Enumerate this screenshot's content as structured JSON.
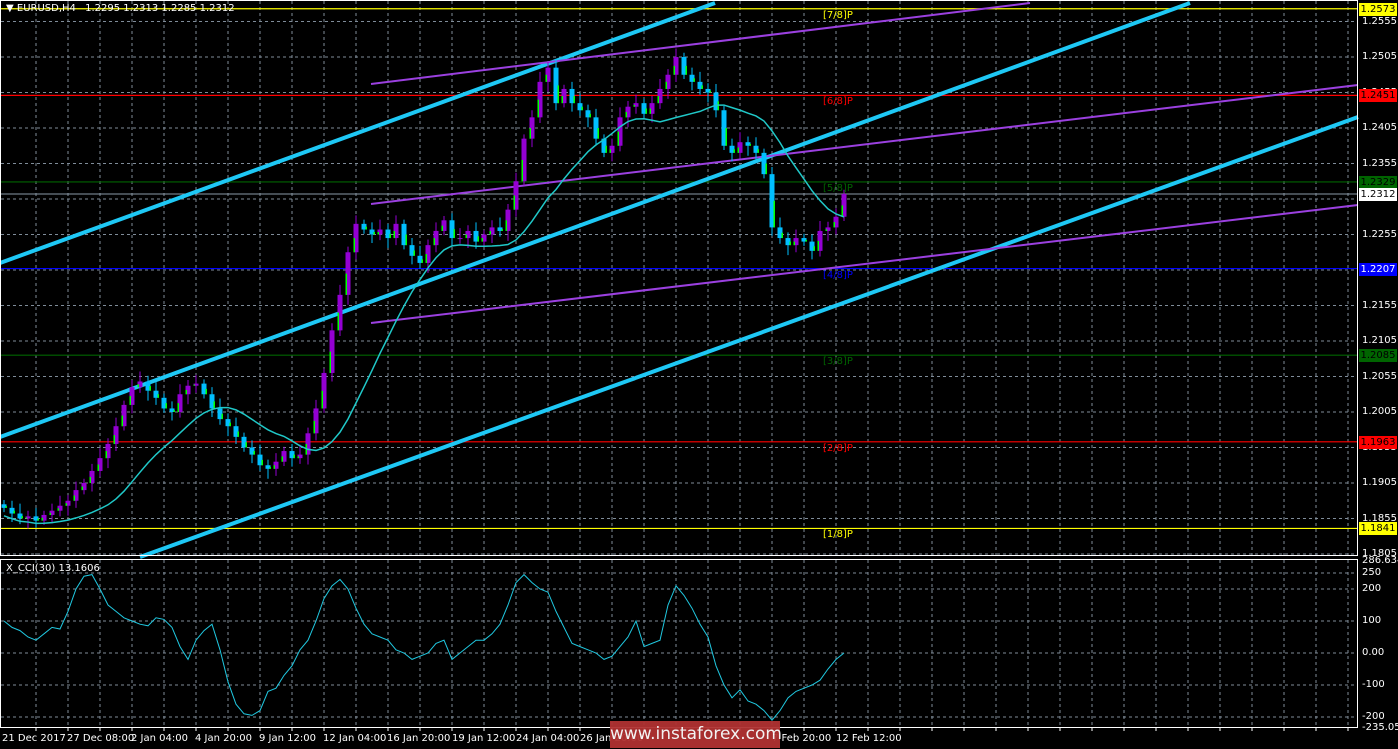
{
  "header": {
    "symbol_label": "EURUSD,H4",
    "ohlc": "1.2295 1.2313 1.2285 1.2312"
  },
  "colors": {
    "background": "#000000",
    "grid": "#7f8c99",
    "bull_candle": "#9400d3",
    "bear_candle": "#00bfff",
    "candle_wick_accent": "#00ff00",
    "moving_average": "#20c8c8",
    "channel_lines": "#1ec8f5",
    "purple_lines": "#9b40e0",
    "cci_line": "#20c8e0"
  },
  "price_axis": {
    "ticks": [
      "1.2555",
      "1.2505",
      "1.2455",
      "1.2405",
      "1.2355",
      "1.2305",
      "1.2255",
      "1.2205",
      "1.2155",
      "1.2105",
      "1.2055",
      "1.2005",
      "1.1955",
      "1.1905",
      "1.1855",
      "1.1805"
    ],
    "range": [
      1.1805,
      1.2573
    ]
  },
  "levels": [
    {
      "price": "1.2573",
      "label": "[7/8]P",
      "color": "#ffff00",
      "text_color": "#000000"
    },
    {
      "price": "1.2451",
      "label": "[6/8]P",
      "color": "#ff0000",
      "text_color": "#000000"
    },
    {
      "price": "1.2329",
      "label": "[5/8]P",
      "color": "#006400",
      "text_color": "#000000"
    },
    {
      "price": "1.2207",
      "label": "[4/8]P",
      "color": "#0000ff",
      "text_color": "#000000"
    },
    {
      "price": "1.2085",
      "label": "[3/8]P",
      "color": "#006400",
      "text_color": "#000000"
    },
    {
      "price": "1.1963",
      "label": "[2/8]P",
      "color": "#ff0000",
      "text_color": "#000000"
    },
    {
      "price": "1.1841",
      "label": "[1/8]P",
      "color": "#ffff00",
      "text_color": "#000000"
    }
  ],
  "current_price": {
    "price": "1.2312",
    "color": "#ffffff",
    "line_color": "#8a9aa8"
  },
  "time_axis": {
    "labels": [
      "21 Dec 2017",
      "27 Dec 08:00",
      "2 Jan 04:00",
      "4 Jan 20:00",
      "9 Jan 12:00",
      "12 Jan 04:00",
      "16 Jan 20:00",
      "19 Jan 12:00",
      "24 Jan 04:00",
      "26 Jan 20:00",
      "7 Feb 20:00",
      "12 Feb 12:00"
    ]
  },
  "cci": {
    "title": "X_CCI(30) 13.1606",
    "axis_ticks": [
      "286.6347",
      "250",
      "200",
      "100",
      "0.00",
      "-100",
      "-200",
      "-235.0531"
    ]
  },
  "chart_data": {
    "type": "candlestick",
    "symbol": "EURUSD",
    "timeframe": "H4",
    "closes": [
      1.187,
      1.1862,
      1.1855,
      1.1858,
      1.1852,
      1.186,
      1.1866,
      1.1873,
      1.188,
      1.1895,
      1.1905,
      1.1922,
      1.194,
      1.196,
      1.1985,
      1.2015,
      1.204,
      1.2048,
      1.2035,
      1.2025,
      1.201,
      1.2005,
      1.203,
      1.2042,
      1.2045,
      1.203,
      1.201,
      1.1995,
      1.1985,
      1.197,
      1.1955,
      1.1945,
      1.193,
      1.1925,
      1.1935,
      1.195,
      1.194,
      1.1945,
      1.1975,
      1.201,
      1.206,
      1.212,
      1.217,
      1.223,
      1.227,
      1.2262,
      1.2255,
      1.2262,
      1.225,
      1.227,
      1.224,
      1.2225,
      1.2215,
      1.224,
      1.226,
      1.2275,
      1.225,
      1.225,
      1.226,
      1.2245,
      1.2255,
      1.2265,
      1.226,
      1.229,
      1.233,
      1.239,
      1.242,
      1.247,
      1.249,
      1.244,
      1.246,
      1.244,
      1.243,
      1.242,
      1.239,
      1.237,
      1.238,
      1.242,
      1.2435,
      1.244,
      1.2425,
      1.244,
      1.246,
      1.248,
      1.2505,
      1.248,
      1.247,
      1.246,
      1.2455,
      1.243,
      1.238,
      1.237,
      1.2385,
      1.238,
      1.237,
      1.234,
      1.2265,
      1.225,
      1.224,
      1.225,
      1.2245,
      1.2232,
      1.226,
      1.2265,
      1.228,
      1.2312
    ],
    "cci_values": [
      100,
      80,
      70,
      50,
      40,
      60,
      80,
      75,
      130,
      200,
      240,
      245,
      200,
      150,
      130,
      110,
      100,
      90,
      85,
      110,
      105,
      80,
      20,
      -20,
      40,
      70,
      90,
      10,
      -90,
      -160,
      -190,
      -195,
      -180,
      -120,
      -110,
      -70,
      -40,
      10,
      40,
      100,
      170,
      210,
      230,
      200,
      140,
      90,
      60,
      50,
      40,
      10,
      0,
      -20,
      -10,
      0,
      30,
      40,
      -20,
      0,
      20,
      40,
      40,
      60,
      90,
      150,
      220,
      245,
      220,
      200,
      190,
      130,
      80,
      30,
      20,
      10,
      0,
      -20,
      -10,
      20,
      50,
      100,
      20,
      30,
      40,
      150,
      210,
      180,
      140,
      90,
      50,
      -40,
      -100,
      -140,
      -115,
      -150,
      -160,
      -180,
      -210,
      -180,
      -140,
      -120,
      -110,
      -100,
      -85,
      -50,
      -20,
      0
    ],
    "cci_range": [
      -235.0531,
      286.6347
    ],
    "grid": true
  },
  "watermark": "www.instaforex.com"
}
